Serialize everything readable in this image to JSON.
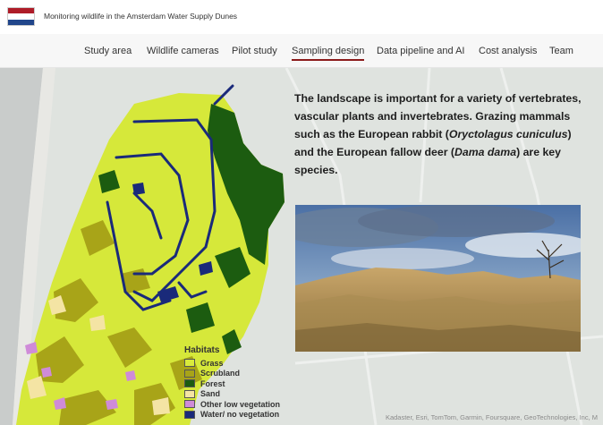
{
  "header": {
    "site_title": "Monitoring wildlife in the Amsterdam Water Supply Dunes",
    "flag_icon": "netherlands-flag-icon"
  },
  "nav": {
    "items": [
      {
        "label": "Study area",
        "active": false
      },
      {
        "label": "Wildlife cameras",
        "active": false
      },
      {
        "label": "Pilot study",
        "active": false
      },
      {
        "label": "Sampling design",
        "active": true
      },
      {
        "label": "Data pipeline and AI",
        "active": false
      },
      {
        "label": "Cost analysis",
        "active": false
      },
      {
        "label": "Team",
        "active": false
      }
    ]
  },
  "main": {
    "headline_part1": "The landscape is important for a variety of vertebrates, vascular plants and invertebrates. Grazing mammals such as the European rabbit (",
    "headline_species1": "Oryctolagus cuniculus",
    "headline_part2": ") and the European fallow deer (",
    "headline_species2": "Dama dama",
    "headline_part3": ") are key species."
  },
  "legend": {
    "title": "Habitats",
    "items": [
      {
        "label": "Grass",
        "color": "#d9ea3c"
      },
      {
        "label": "Scrubland",
        "color": "#a8a418"
      },
      {
        "label": "Forest",
        "color": "#1c5c10"
      },
      {
        "label": "Sand",
        "color": "#f4e4a4"
      },
      {
        "label": "Other low vegetation",
        "color": "#cf8bd8"
      },
      {
        "label": "Water/ no vegetation",
        "color": "#1a2a7a"
      }
    ]
  },
  "map": {
    "attribution": "Kadaster, Esri, TomTom, Garmin, Foursquare, GeoTechnologies, Inc, M"
  },
  "colors": {
    "nav_active_underline": "#8b1a1a",
    "map_background": "#dfe3df",
    "sea": "#c9cccb"
  }
}
